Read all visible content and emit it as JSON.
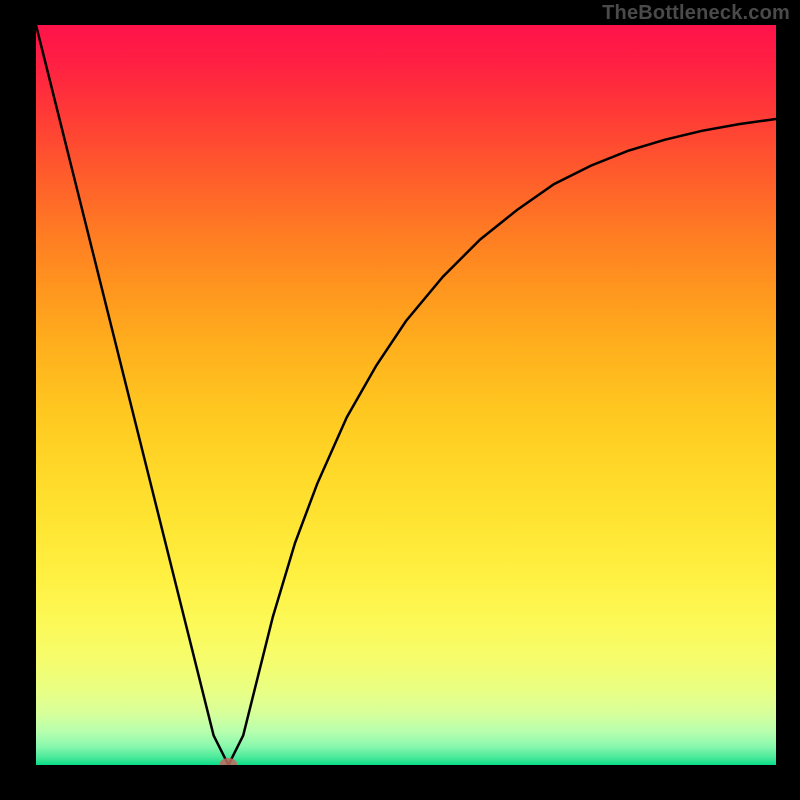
{
  "watermark": "TheBottleneck.com",
  "chart_data": {
    "type": "line",
    "title": "",
    "xlabel": "",
    "ylabel": "",
    "xlim": [
      0,
      100
    ],
    "ylim": [
      0,
      100
    ],
    "grid": false,
    "legend": false,
    "series": [
      {
        "name": "curve",
        "x": [
          0,
          5,
          10,
          15,
          20,
          24,
          26,
          28,
          30,
          32,
          35,
          38,
          42,
          46,
          50,
          55,
          60,
          65,
          70,
          75,
          80,
          85,
          90,
          95,
          100
        ],
        "y": [
          100,
          80,
          60,
          40,
          20,
          4,
          0,
          4,
          12,
          20,
          30,
          38,
          47,
          54,
          60,
          66,
          71,
          75,
          78.5,
          81,
          83,
          84.5,
          85.7,
          86.6,
          87.3
        ]
      }
    ],
    "markers": [
      {
        "name": "minimum",
        "x": 26,
        "y": 0
      }
    ],
    "gradient_stops": [
      {
        "pos": 0,
        "color": "#ff134a"
      },
      {
        "pos": 50,
        "color": "#ffc720"
      },
      {
        "pos": 75,
        "color": "#fff143"
      },
      {
        "pos": 100,
        "color": "#07db86"
      }
    ]
  }
}
